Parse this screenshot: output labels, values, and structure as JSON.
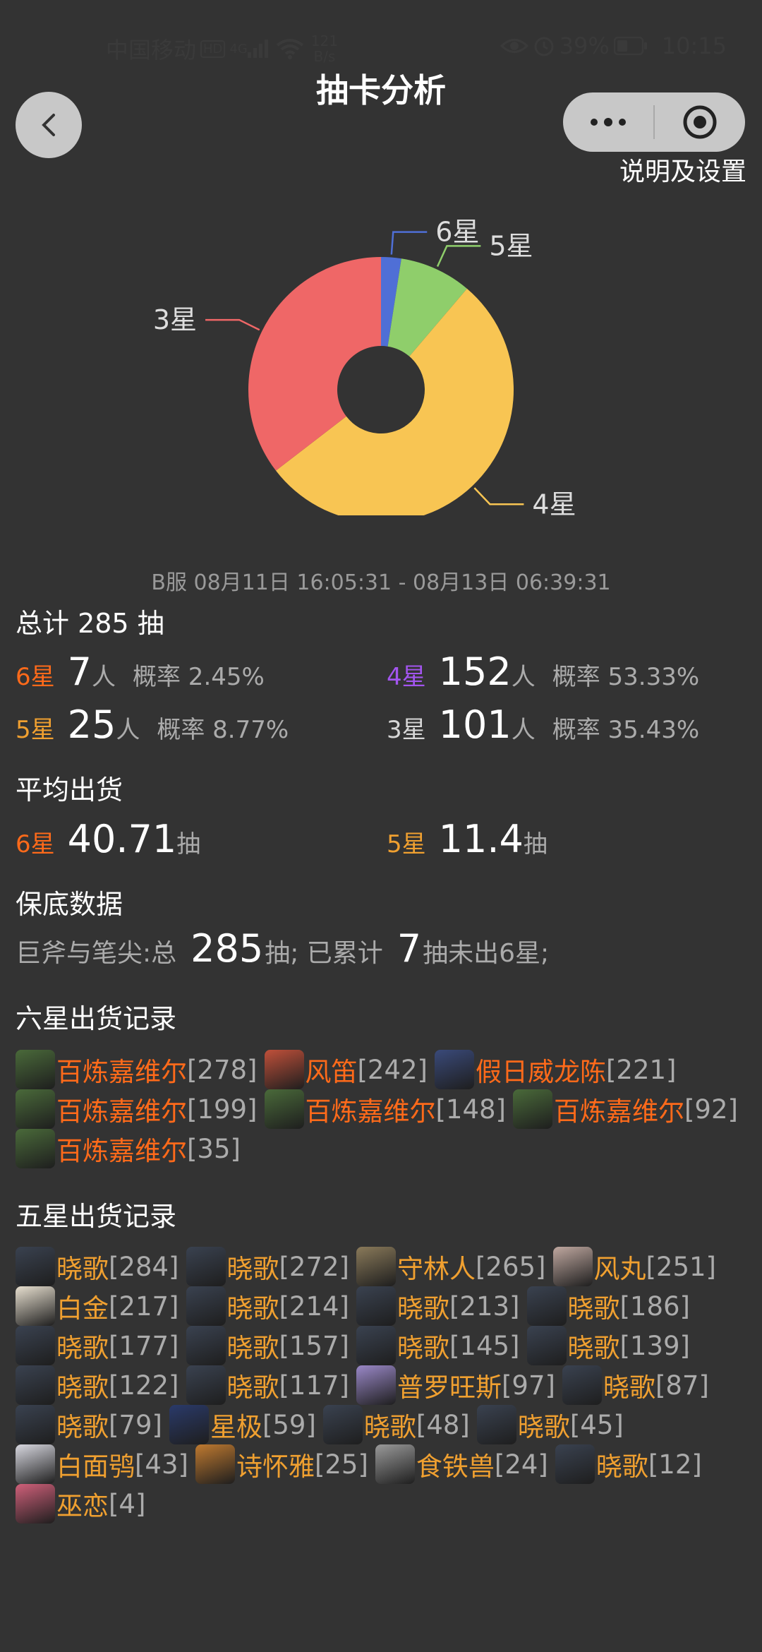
{
  "status_bar": {
    "carrier": "中国移动",
    "hd": "HD",
    "network": "4G",
    "speed_value": "121",
    "speed_unit": "B/s",
    "battery": "39%",
    "time": "10:15"
  },
  "header": {
    "title": "抽卡分析",
    "settings_link": "说明及设置"
  },
  "chart_data": {
    "type": "pie",
    "style": "donut",
    "slices": [
      {
        "label": "6星",
        "value": 7,
        "color": "#4f6fd6"
      },
      {
        "label": "5星",
        "value": 25,
        "color": "#8fce6b"
      },
      {
        "label": "4星",
        "value": 152,
        "color": "#f8c553"
      },
      {
        "label": "3星",
        "value": 101,
        "color": "#ef6767"
      }
    ]
  },
  "summary": {
    "date_range": "B服  08月11日 16:05:31  -  08月13日 06:39:31",
    "total_label": "总计 285 抽",
    "rows": [
      {
        "label": "6星",
        "count": "7",
        "unit": "人",
        "rate": "概率 2.45%",
        "color": "#ff6a1a"
      },
      {
        "label": "4星",
        "count": "152",
        "unit": "人",
        "rate": "概率 53.33%",
        "color": "#a355ef"
      },
      {
        "label": "5星",
        "count": "25",
        "unit": "人",
        "rate": "概率 8.77%",
        "color": "#f0a030"
      },
      {
        "label": "3星",
        "count": "101",
        "unit": "人",
        "rate": "概率 35.43%",
        "color": "#d7d7d7"
      }
    ]
  },
  "average": {
    "title": "平均出货",
    "six_label": "6星",
    "six_value": "40.71",
    "six_unit": "抽",
    "five_label": "5星",
    "five_value": "11.4",
    "five_unit": "抽"
  },
  "pity": {
    "title": "保底数据",
    "prefix": "巨斧与笔尖:总",
    "total": "285",
    "mid": "抽; 已累计",
    "accum": "7",
    "suffix": "抽未出6星;"
  },
  "six_star": {
    "title": "六星出货记录",
    "records": [
      {
        "name": "百炼嘉维尔",
        "pull": "[278]",
        "avatar_color": "#4a6a3a"
      },
      {
        "name": "风笛",
        "pull": "[242]",
        "avatar_color": "#c0503a"
      },
      {
        "name": "假日威龙陈",
        "pull": "[221]",
        "avatar_color": "#3a4a7a"
      },
      {
        "name": "百炼嘉维尔",
        "pull": "[199]",
        "avatar_color": "#4a6a3a"
      },
      {
        "name": "百炼嘉维尔",
        "pull": "[148]",
        "avatar_color": "#4a6a3a"
      },
      {
        "name": "百炼嘉维尔",
        "pull": "[92]",
        "avatar_color": "#4a6a3a"
      },
      {
        "name": "百炼嘉维尔",
        "pull": "[35]",
        "avatar_color": "#4a6a3a"
      }
    ]
  },
  "five_star": {
    "title": "五星出货记录",
    "records": [
      {
        "name": "晓歌",
        "pull": "[284]",
        "avatar_color": "#3a4250"
      },
      {
        "name": "晓歌",
        "pull": "[272]",
        "avatar_color": "#3a4250"
      },
      {
        "name": "守林人",
        "pull": "[265]",
        "avatar_color": "#8a7a5a"
      },
      {
        "name": "风丸",
        "pull": "[251]",
        "avatar_color": "#c0a8a0"
      },
      {
        "name": "白金",
        "pull": "[217]",
        "avatar_color": "#e8e0d0"
      },
      {
        "name": "晓歌",
        "pull": "[214]",
        "avatar_color": "#3a4250"
      },
      {
        "name": "晓歌",
        "pull": "[213]",
        "avatar_color": "#3a4250"
      },
      {
        "name": "晓歌",
        "pull": "[186]",
        "avatar_color": "#3a4250"
      },
      {
        "name": "晓歌",
        "pull": "[177]",
        "avatar_color": "#3a4250"
      },
      {
        "name": "晓歌",
        "pull": "[157]",
        "avatar_color": "#3a4250"
      },
      {
        "name": "晓歌",
        "pull": "[145]",
        "avatar_color": "#3a4250"
      },
      {
        "name": "晓歌",
        "pull": "[139]",
        "avatar_color": "#3a4250"
      },
      {
        "name": "晓歌",
        "pull": "[122]",
        "avatar_color": "#3a4250"
      },
      {
        "name": "晓歌",
        "pull": "[117]",
        "avatar_color": "#3a4250"
      },
      {
        "name": "普罗旺斯",
        "pull": "[97]",
        "avatar_color": "#9a88c8"
      },
      {
        "name": "晓歌",
        "pull": "[87]",
        "avatar_color": "#3a4250"
      },
      {
        "name": "晓歌",
        "pull": "[79]",
        "avatar_color": "#3a4250"
      },
      {
        "name": "星极",
        "pull": "[59]",
        "avatar_color": "#2a3a6a"
      },
      {
        "name": "晓歌",
        "pull": "[48]",
        "avatar_color": "#3a4250"
      },
      {
        "name": "晓歌",
        "pull": "[45]",
        "avatar_color": "#3a4250"
      },
      {
        "name": "白面鸮",
        "pull": "[43]",
        "avatar_color": "#d8d8e0"
      },
      {
        "name": "诗怀雅",
        "pull": "[25]",
        "avatar_color": "#c07a30"
      },
      {
        "name": "食铁兽",
        "pull": "[24]",
        "avatar_color": "#9a9a9a"
      },
      {
        "name": "晓歌",
        "pull": "[12]",
        "avatar_color": "#3a4250"
      },
      {
        "name": "巫恋",
        "pull": "[4]",
        "avatar_color": "#d0607a"
      }
    ]
  },
  "colors": {
    "background": "#333333",
    "six_star": "#ff6a1a",
    "five_star": "#f0a030",
    "four_star": "#a355ef",
    "muted": "#ababab"
  }
}
